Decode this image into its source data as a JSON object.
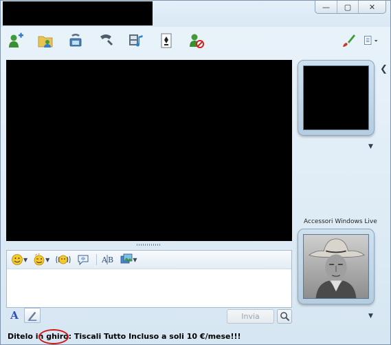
{
  "window": {
    "controls": {
      "minimize": "—",
      "maximize": "▢",
      "close": "✕"
    }
  },
  "toolbar": {
    "items": [
      {
        "name": "add-contact-icon"
      },
      {
        "name": "share-folder-icon"
      },
      {
        "name": "video-call-icon"
      },
      {
        "name": "call-icon"
      },
      {
        "name": "media-icon"
      },
      {
        "name": "games-icon"
      },
      {
        "name": "block-contact-icon"
      },
      {
        "name": "paint-brush-icon"
      },
      {
        "name": "show-menu-icon"
      }
    ]
  },
  "compose": {
    "send_label": "Invia",
    "text_value": ""
  },
  "status": {
    "prefix": "Ditelo in ",
    "circled": "ghiro:",
    "suffix": " Tiscali Tutto Incluso a soli 10 €/mese!!!"
  },
  "sidebar": {
    "accessories_label": "Accessori Windows Live"
  },
  "colors": {
    "accent_red": "#d01515",
    "window_bg": "#dfecf6",
    "frame_border": "#8ea8bf"
  }
}
